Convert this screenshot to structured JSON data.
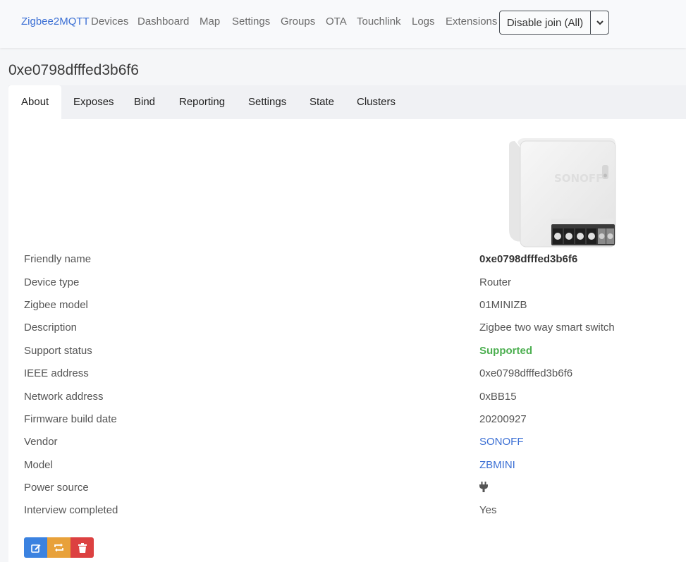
{
  "navbar": {
    "brand": "Zigbee2MQTT",
    "items": [
      "Devices",
      "Dashboard",
      "Map",
      "Settings",
      "Groups",
      "OTA",
      "Touchlink",
      "Logs",
      "Extensions"
    ],
    "join_label": "Disable join (All)"
  },
  "page": {
    "title": "0xe0798dfffed3b6f6"
  },
  "tabs": [
    "About",
    "Exposes",
    "Bind",
    "Reporting",
    "Settings",
    "State",
    "Clusters"
  ],
  "device": {
    "image_brand_text": "SONOFF",
    "rows": [
      {
        "label": "Friendly name",
        "value": "0xe0798dfffed3b6f6"
      },
      {
        "label": "Device type",
        "value": "Router"
      },
      {
        "label": "Zigbee model",
        "value": "01MINIZB"
      },
      {
        "label": "Description",
        "value": "Zigbee two way smart switch"
      },
      {
        "label": "Support status",
        "value": "Supported"
      },
      {
        "label": "IEEE address",
        "value": "0xe0798dfffed3b6f6"
      },
      {
        "label": "Network address",
        "value": "0xBB15"
      },
      {
        "label": "Firmware build date",
        "value": "20200927"
      },
      {
        "label": "Vendor",
        "value": "SONOFF"
      },
      {
        "label": "Model",
        "value": "ZBMINI"
      },
      {
        "label": "Power source",
        "value": "",
        "icon": "plug-icon"
      },
      {
        "label": "Interview completed",
        "value": "Yes"
      }
    ]
  },
  "actions": [
    {
      "icon": "edit-icon",
      "color": "#3b82e0"
    },
    {
      "icon": "reconfigure-icon",
      "color": "#e8a13a"
    },
    {
      "icon": "trash-icon",
      "color": "#dc4141"
    }
  ],
  "colors": {
    "brand": "#3b6fd4",
    "supported": "#4caf50",
    "link": "#3b6fd4"
  }
}
